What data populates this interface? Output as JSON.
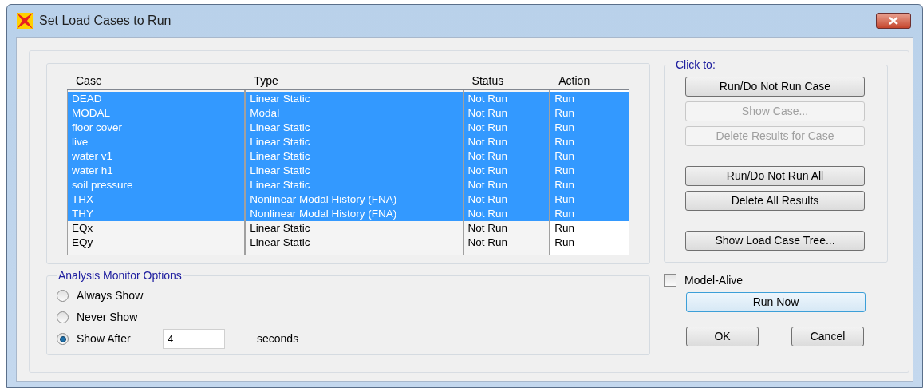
{
  "window": {
    "title": "Set Load Cases to Run"
  },
  "table": {
    "columns": [
      "Case",
      "Type",
      "Status",
      "Action"
    ],
    "rows": [
      {
        "case": "DEAD",
        "type": "Linear Static",
        "status": "Not Run",
        "action": "Run",
        "selected": true
      },
      {
        "case": "MODAL",
        "type": "Modal",
        "status": "Not Run",
        "action": "Run",
        "selected": true
      },
      {
        "case": "floor cover",
        "type": "Linear Static",
        "status": "Not Run",
        "action": "Run",
        "selected": true
      },
      {
        "case": "live",
        "type": "Linear Static",
        "status": "Not Run",
        "action": "Run",
        "selected": true
      },
      {
        "case": "water v1",
        "type": "Linear Static",
        "status": "Not Run",
        "action": "Run",
        "selected": true
      },
      {
        "case": "water h1",
        "type": "Linear Static",
        "status": "Not Run",
        "action": "Run",
        "selected": true
      },
      {
        "case": "soil pressure",
        "type": "Linear Static",
        "status": "Not Run",
        "action": "Run",
        "selected": true
      },
      {
        "case": "THX",
        "type": "Nonlinear Modal History (FNA)",
        "status": "Not Run",
        "action": "Run",
        "selected": true
      },
      {
        "case": "THY",
        "type": "Nonlinear Modal History (FNA)",
        "status": "Not Run",
        "action": "Run",
        "selected": true
      },
      {
        "case": "EQx",
        "type": "Linear Static",
        "status": "Not Run",
        "action": "Run",
        "selected": false
      },
      {
        "case": "EQy",
        "type": "Linear Static",
        "status": "Not Run",
        "action": "Run",
        "selected": false
      }
    ]
  },
  "click_to": {
    "title": "Click to:",
    "button_groups": [
      [
        {
          "label": "Run/Do Not Run Case",
          "disabled": false
        },
        {
          "label": "Show Case...",
          "disabled": true
        },
        {
          "label": "Delete Results for Case",
          "disabled": true
        }
      ],
      [
        {
          "label": "Run/Do Not Run All",
          "disabled": false
        },
        {
          "label": "Delete All Results",
          "disabled": false
        }
      ],
      [
        {
          "label": "Show Load Case Tree...",
          "disabled": false
        }
      ]
    ]
  },
  "monitor": {
    "title": "Analysis Monitor Options",
    "options": [
      {
        "label": "Always Show",
        "selected": false
      },
      {
        "label": "Never Show",
        "selected": false
      },
      {
        "label": "Show After",
        "selected": true
      }
    ],
    "seconds_value": "4",
    "seconds_unit": "seconds"
  },
  "model_alive": {
    "label": "Model-Alive",
    "checked": false
  },
  "run_now": {
    "label": "Run Now"
  },
  "buttons": [
    "OK",
    "Cancel"
  ]
}
